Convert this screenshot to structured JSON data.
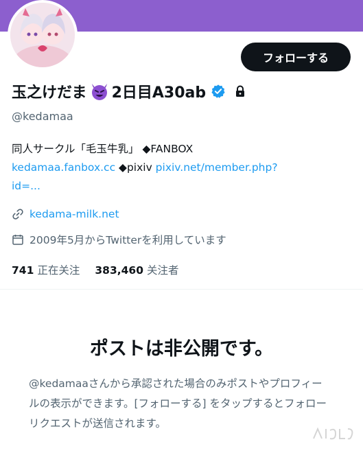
{
  "colors": {
    "banner": "#8c5fce",
    "accent_link": "#1d9bf0",
    "verified": "#1d9bf0",
    "text_primary": "#0f1419",
    "text_secondary": "#536471"
  },
  "profile": {
    "display_name_prefix": "玉之けだま",
    "display_name_suffix": "2日目A30ab",
    "name_emoji_icon": "smiling-devil-icon",
    "handle": "@kedamaa",
    "follow_label": "フォローする"
  },
  "bio": {
    "line1_text": "同人サークル「毛玉牛乳」 ◆FANBOX",
    "fanbox_link": "kedamaa.fanbox.cc",
    "pixiv_text": " ◆pixiv ",
    "pixiv_link": "pixiv.net/member.php?",
    "pixiv_link_cont": "id=..."
  },
  "meta": {
    "website": "kedama-milk.net",
    "joined": "2009年5月からTwitterを利用しています"
  },
  "stats": {
    "following_count": "741",
    "following_label": "正在关注",
    "followers_count": "383,460",
    "followers_label": "关注者"
  },
  "private_notice": {
    "title": "ポストは非公開です。",
    "description": "@kedamaaさんから承認された場合のみポストやプロフィールの表示ができます。[フォローする] をタップするとフォローリクエストが送信されます。"
  }
}
